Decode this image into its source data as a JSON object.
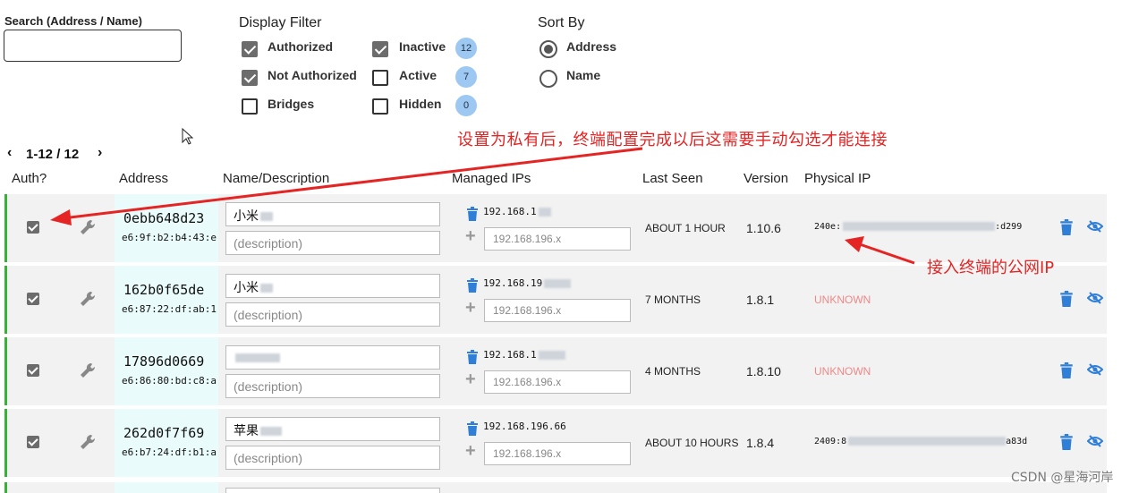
{
  "search": {
    "label": "Search (Address / Name)",
    "value": ""
  },
  "display_filter": {
    "title": "Display Filter",
    "options": [
      {
        "label": "Authorized",
        "checked": true
      },
      {
        "label": "Not Authorized",
        "checked": true
      },
      {
        "label": "Bridges",
        "checked": false
      },
      {
        "label": "Inactive",
        "checked": true,
        "count": "12"
      },
      {
        "label": "Active",
        "checked": false,
        "count": "7"
      },
      {
        "label": "Hidden",
        "checked": false,
        "count": "0"
      }
    ]
  },
  "sort_by": {
    "title": "Sort By",
    "options": [
      {
        "label": "Address",
        "selected": true
      },
      {
        "label": "Name",
        "selected": false
      }
    ]
  },
  "pager": {
    "text": "1-12 / 12",
    "prev": "‹",
    "next": "›"
  },
  "columns": [
    "Auth?",
    "Address",
    "Name/Description",
    "Managed IPs",
    "Last Seen",
    "Version",
    "Physical IP"
  ],
  "rows": [
    {
      "authorized": true,
      "node_id": "0ebb648d23",
      "mac": "e6:9f:b2:b4:43:e",
      "name": "小米",
      "description_placeholder": "(description)",
      "managed_ip": "192.168.1",
      "ip_placeholder": "192.168.196.x",
      "last_seen": "ABOUT 1 HOUR",
      "version": "1.10.6",
      "physical_ip_prefix": "240e:",
      "physical_ip_suffix": ":d299"
    },
    {
      "authorized": true,
      "node_id": "162b0f65de",
      "mac": "e6:87:22:df:ab:1",
      "name": "小米",
      "description_placeholder": "(description)",
      "managed_ip": "192.168.19",
      "ip_placeholder": "192.168.196.x",
      "last_seen": "7 MONTHS",
      "version": "1.8.1",
      "physical_ip": "UNKNOWN"
    },
    {
      "authorized": true,
      "node_id": "17896d0669",
      "mac": "e6:86:80:bd:c8:a",
      "name": "",
      "description_placeholder": "(description)",
      "managed_ip": "192.168.1",
      "ip_placeholder": "192.168.196.x",
      "last_seen": "4 MONTHS",
      "version": "1.8.10",
      "physical_ip": "UNKNOWN"
    },
    {
      "authorized": true,
      "node_id": "262d0f7f69",
      "mac": "e6:b7:24:df:b1:a",
      "name": "苹果",
      "description_placeholder": "(description)",
      "managed_ip": "192.168.196.66",
      "ip_placeholder": "192.168.196.x",
      "last_seen": "ABOUT 10 HOURS",
      "version": "1.8.4",
      "physical_ip_prefix": "2409:8",
      "physical_ip_suffix": "a83d"
    }
  ],
  "annotations": {
    "top": "设置为私有后，终端配置完成以后这需要手动勾选才能连接",
    "right": "接入终端的公网IP"
  },
  "watermark": "CSDN @星海河岸",
  "colors": {
    "accent_blue": "#2f7ed8",
    "annotation_red": "#e52424",
    "authorized_green": "#34b334",
    "badge_blue": "#9cc8f2"
  }
}
